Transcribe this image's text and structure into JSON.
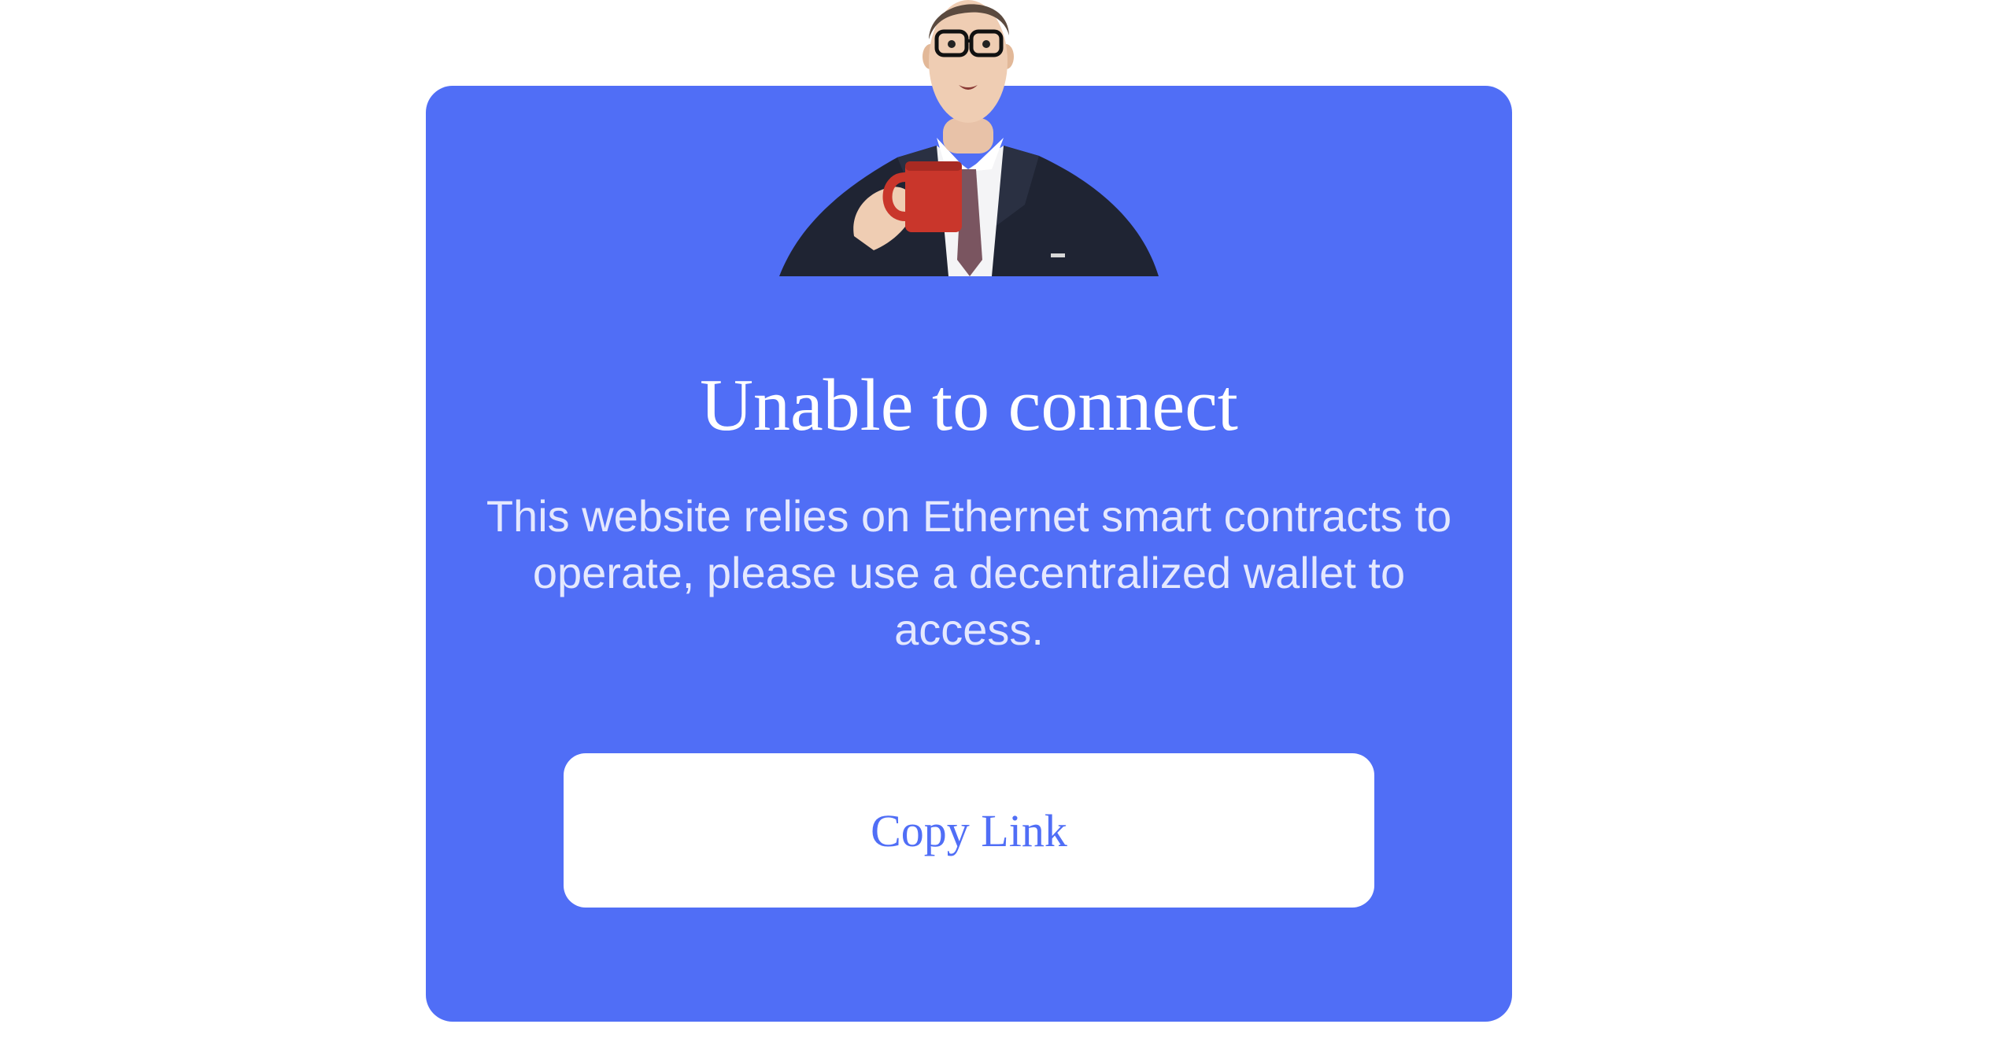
{
  "modal": {
    "title": "Unable to connect",
    "description": "This website relies on Ethernet smart contracts to operate, please use a decentralized wallet to access.",
    "copy_button_label": "Copy Link",
    "mascot_icon": "businessman-with-coffee-mug-icon"
  },
  "colors": {
    "page_background": "#ffffff",
    "modal_background": "#506ef6",
    "button_background": "#ffffff",
    "button_text": "#506ef6",
    "title_text": "#ffffff",
    "description_text": "#e4e8fe"
  }
}
